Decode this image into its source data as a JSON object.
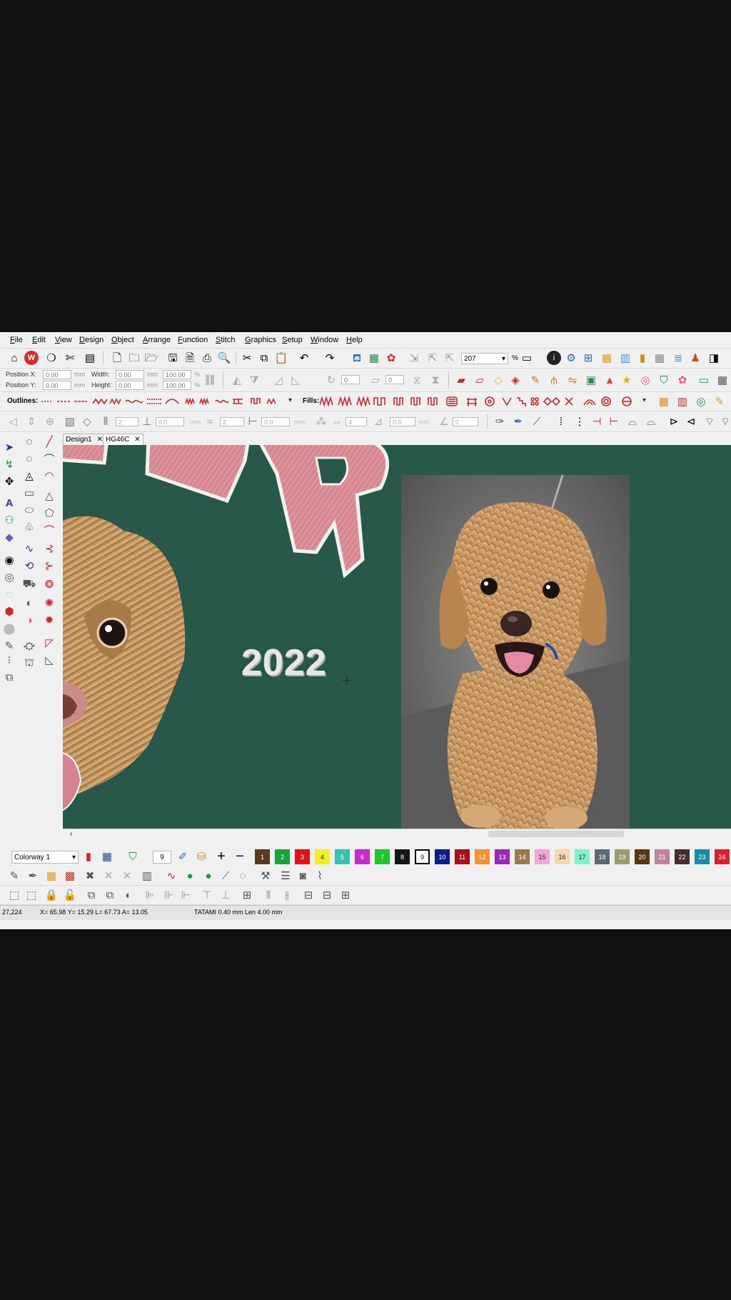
{
  "menu": [
    "File",
    "Edit",
    "View",
    "Design",
    "Object",
    "Arrange",
    "Function",
    "Stitch",
    "Graphics",
    "Setup",
    "Window",
    "Help"
  ],
  "toolbar": {
    "zoom_value": "207",
    "zoom_unit": "%"
  },
  "props": {
    "position_x_label": "Position X:",
    "position_x": "0.00",
    "position_y_label": "Position Y:",
    "position_y": "0.00",
    "unit": "mm",
    "width_label": "Width:",
    "width": "0.00",
    "height_label": "Height:",
    "height": "0.00",
    "scale_w": "100.00",
    "scale_h": "100.00",
    "pct": "%",
    "rotate_value": "0",
    "skew_value": "0"
  },
  "stitch_bar": {
    "outlines_label": "Outlines:",
    "fills_label": "Fills:"
  },
  "row4": {
    "v1": "2",
    "v2": "0.0",
    "v3": "2",
    "v4": "0.0",
    "v5": "4",
    "v6": "0.0",
    "v7": "0",
    "mm": "mm"
  },
  "tabs": [
    {
      "label": "Design1"
    },
    {
      "label": "HG46C"
    }
  ],
  "canvas": {
    "design_text": "2022"
  },
  "colorbar": {
    "colorway": "Colorway 1",
    "current_needle": "9",
    "swatches": [
      {
        "n": "1",
        "color": "#5a3a1e"
      },
      {
        "n": "2",
        "color": "#1aa33a"
      },
      {
        "n": "3",
        "color": "#e0151b"
      },
      {
        "n": "4",
        "color": "#f2ee2a"
      },
      {
        "n": "5",
        "color": "#3bbfb0"
      },
      {
        "n": "6",
        "color": "#c42cc8"
      },
      {
        "n": "7",
        "color": "#22c32f"
      },
      {
        "n": "8",
        "color": "#161616"
      },
      {
        "n": "9",
        "color": "#ffffff"
      },
      {
        "n": "10",
        "color": "#0c1c8c"
      },
      {
        "n": "11",
        "color": "#a51218"
      },
      {
        "n": "12",
        "color": "#f29233"
      },
      {
        "n": "13",
        "color": "#9a28b4"
      },
      {
        "n": "14",
        "color": "#9a7a4a"
      },
      {
        "n": "15",
        "color": "#f2a6d6"
      },
      {
        "n": "16",
        "color": "#f6d8b0"
      },
      {
        "n": "17",
        "color": "#7ff2c6"
      },
      {
        "n": "18",
        "color": "#5b6a70"
      },
      {
        "n": "19",
        "color": "#9a9a6e"
      },
      {
        "n": "20",
        "color": "#5a3516"
      },
      {
        "n": "21",
        "color": "#c0829a"
      },
      {
        "n": "22",
        "color": "#4a2a2e"
      },
      {
        "n": "23",
        "color": "#1a8aa8"
      },
      {
        "n": "24",
        "color": "#d8222e"
      }
    ]
  },
  "status": {
    "coords": "27,224",
    "measure": "X= 65.98 Y= 15.29 L= 67.73 A= 13.05",
    "stitch": "TATAMI  0.40 mm Len  4.00 mm"
  }
}
